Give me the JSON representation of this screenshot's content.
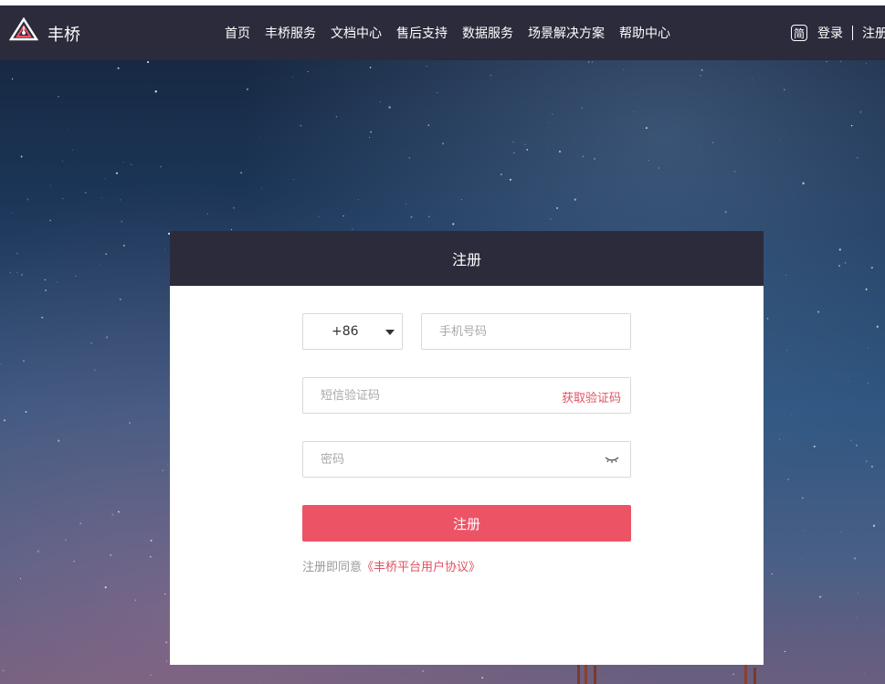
{
  "brand": {
    "name": "丰桥"
  },
  "nav": {
    "items": [
      "首页",
      "丰桥服务",
      "文档中心",
      "售后支持",
      "数据服务",
      "场景解决方案",
      "帮助中心"
    ],
    "lang": "简",
    "login": "登录",
    "register": "注册"
  },
  "form": {
    "title": "注册",
    "country_code": "+86",
    "phone_placeholder": "手机号码",
    "sms_placeholder": "短信验证码",
    "get_code": "获取验证码",
    "password_placeholder": "密码",
    "submit": "注册",
    "agree_text": "注册即同意",
    "agree_link": "《丰桥平台用户协议》"
  },
  "icons": {
    "logo": "triangle-logo-icon",
    "password_toggle": "eye-closed-icon",
    "language": "language-icon",
    "dropdown": "caret-down-icon"
  },
  "colors": {
    "accent": "#ec5466",
    "link": "#e05261",
    "header": "#2c2b3c"
  }
}
